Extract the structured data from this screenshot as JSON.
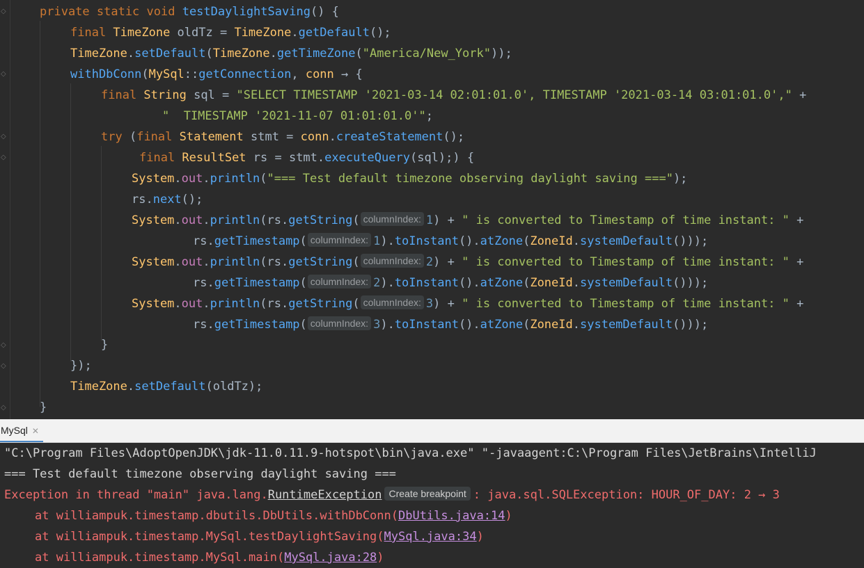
{
  "editor": {
    "hint_label": "columnIndex:",
    "l1": {
      "a": "private static void ",
      "b": "testDaylightSaving",
      "c": "() {"
    },
    "l2": {
      "a": "final ",
      "b": "TimeZone ",
      "c": "oldTz = ",
      "d": "TimeZone",
      "e": ".",
      "f": "getDefault",
      "g": "();"
    },
    "l3": {
      "a": "TimeZone",
      "b": ".",
      "c": "setDefault",
      "d": "(",
      "e": "TimeZone",
      "f": ".",
      "g": "getTimeZone",
      "h": "(",
      "i": "\"America/New_York\"",
      "j": "));"
    },
    "l4": {
      "a": "withDbConn",
      "b": "(",
      "c": "MySql",
      "d": "::",
      "e": "getConnection",
      "f": ", ",
      "g": "conn",
      "h": " → {"
    },
    "l5": {
      "a": "final ",
      "b": "String ",
      "c": "sql = ",
      "d": "\"SELECT TIMESTAMP '2021-03-14 02:01:01.0', TIMESTAMP '2021-03-14 03:01:01.0',\"",
      "e": " +"
    },
    "l6": {
      "a": "\"  TIMESTAMP '2021-11-07 01:01:01.0'\"",
      "b": ";"
    },
    "l7": {
      "a": "try ",
      "b": "(",
      "c": "final ",
      "d": "Statement ",
      "e": "stmt = ",
      "f": "conn",
      "g": ".",
      "h": "createStatement",
      "i": "();"
    },
    "l8": {
      "a": "final ",
      "b": "ResultSet ",
      "c": "rs = stmt.",
      "d": "executeQuery",
      "e": "(sql);) {"
    },
    "l9": {
      "a": "System",
      "b": ".",
      "c": "out",
      "d": ".",
      "e": "println",
      "f": "(",
      "g": "\"=== Test default timezone observing daylight saving ===\"",
      "h": ");"
    },
    "l10": {
      "a": "rs.",
      "b": "next",
      "c": "();"
    },
    "l11": {
      "a": "System",
      "b": ".",
      "c": "out",
      "d": ".",
      "e": "println",
      "f": "(rs.",
      "g": "getString",
      "h": "(",
      "i": "1",
      "j": ") + ",
      "k": "\" is converted to Timestamp of time instant: \"",
      "l": " +"
    },
    "l12": {
      "a": "rs.",
      "b": "getTimestamp",
      "c": "(",
      "d": "1",
      "e": ").",
      "f": "toInstant",
      "g": "().",
      "h": "atZone",
      "i": "(",
      "j": "ZoneId",
      "k": ".",
      "l": "systemDefault",
      "m": "()));"
    },
    "l13": {
      "i": "2"
    },
    "l14": {
      "d": "2"
    },
    "l15": {
      "i": "3"
    },
    "l16": {
      "d": "3"
    },
    "l17": "}",
    "l18": "});",
    "l19": {
      "a": "TimeZone",
      "b": ".",
      "c": "setDefault",
      "d": "(oldTz);"
    },
    "l20": "}"
  },
  "tab": {
    "label": "MySql",
    "close": "✕"
  },
  "console": {
    "line1": "\"C:\\Program Files\\AdoptOpenJDK\\jdk-11.0.11.9-hotspot\\bin\\java.exe\" \"-javaagent:C:\\Program Files\\JetBrains\\IntelliJ",
    "line2": "=== Test default timezone observing daylight saving ===",
    "exc_prefix": "Exception in thread \"main\" java.lang.",
    "exc_class": "RuntimeException",
    "breakpoint_hint": "Create breakpoint",
    "exc_suffix": ": java.sql.SQLException: HOUR_OF_DAY: 2 → 3",
    "trace": [
      {
        "prefix": "at williampuk.timestamp.dbutils.DbUtils.withDbConn(",
        "link": "DbUtils.java:14",
        "suffix": ")"
      },
      {
        "prefix": "at williampuk.timestamp.MySql.testDaylightSaving(",
        "link": "MySql.java:34",
        "suffix": ")"
      },
      {
        "prefix": "at williampuk.timestamp.MySql.main(",
        "link": "MySql.java:28",
        "suffix": ")"
      }
    ]
  }
}
